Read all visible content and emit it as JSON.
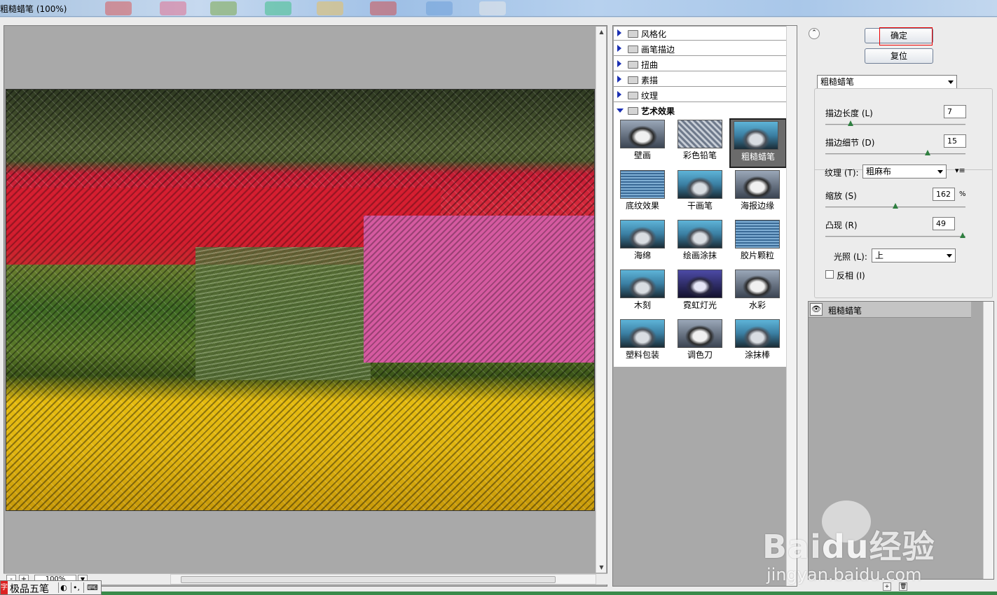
{
  "window": {
    "title": "粗糙蜡笔 (100%)"
  },
  "preview": {
    "zoom": "100%",
    "zoom_out": "-",
    "zoom_in": "+"
  },
  "gallery": {
    "categories": [
      {
        "label": "风格化",
        "expanded": false
      },
      {
        "label": "画笔描边",
        "expanded": false
      },
      {
        "label": "扭曲",
        "expanded": false
      },
      {
        "label": "素描",
        "expanded": false
      },
      {
        "label": "纹理",
        "expanded": false
      },
      {
        "label": "艺术效果",
        "expanded": true
      }
    ],
    "filters": [
      {
        "label": "壁画"
      },
      {
        "label": "彩色铅笔"
      },
      {
        "label": "粗糙蜡笔",
        "selected": true
      },
      {
        "label": "底纹效果"
      },
      {
        "label": "干画笔"
      },
      {
        "label": "海报边缘"
      },
      {
        "label": "海绵"
      },
      {
        "label": "绘画涂抹"
      },
      {
        "label": "胶片颗粒"
      },
      {
        "label": "木刻"
      },
      {
        "label": "霓虹灯光"
      },
      {
        "label": "水彩"
      },
      {
        "label": "塑料包装"
      },
      {
        "label": "调色刀"
      },
      {
        "label": "涂抹棒"
      }
    ]
  },
  "buttons": {
    "ok": "确定",
    "reset": "复位"
  },
  "settings": {
    "filter_select": "粗糙蜡笔",
    "stroke_length": {
      "label": "描边长度 (L)",
      "value": "7",
      "level": 0.18
    },
    "stroke_detail": {
      "label": "描边细节 (D)",
      "value": "15",
      "level": 0.73
    },
    "texture": {
      "label": "纹理 (T):",
      "value": "粗麻布"
    },
    "scaling": {
      "label": "缩放 (S)",
      "value": "162",
      "unit": "%",
      "level": 0.5
    },
    "relief": {
      "label": "凸现 (R)",
      "value": "49",
      "level": 0.98
    },
    "light": {
      "label": "光照 (L):",
      "value": "上"
    },
    "invert": {
      "label": "反相 (I)",
      "checked": false
    }
  },
  "layers": [
    {
      "label": "粗糙蜡笔",
      "visible": true
    }
  ],
  "ime": {
    "name": "极品五笔"
  },
  "watermark": {
    "brand": "Bai",
    "brand2": "du",
    "brand_cn": "经验",
    "url": "jingyan.baidu.com"
  }
}
